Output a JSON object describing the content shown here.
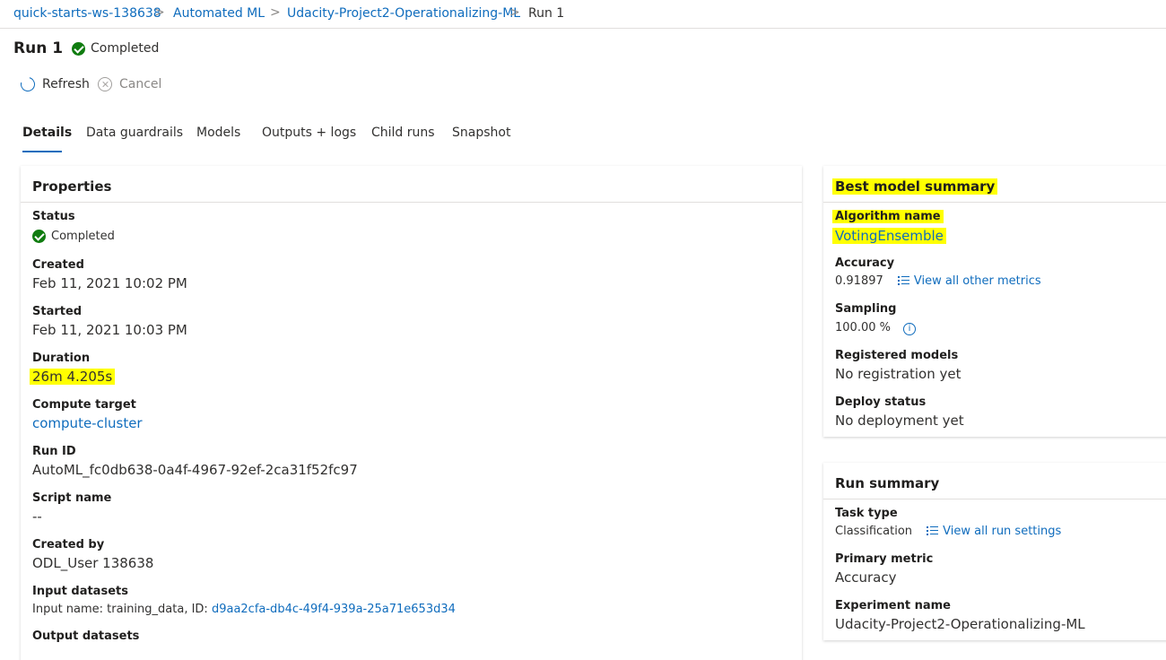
{
  "breadcrumb": {
    "items": [
      "quick-starts-ws-138638",
      "Automated ML",
      "Udacity-Project2-Operationalizing-ML",
      "Run 1"
    ],
    "separator": ">"
  },
  "header": {
    "title": "Run 1",
    "status": "Completed"
  },
  "commands": {
    "refresh": "Refresh",
    "cancel": "Cancel"
  },
  "tabs": [
    "Details",
    "Data guardrails",
    "Models",
    "Outputs + logs",
    "Child runs",
    "Snapshot"
  ],
  "properties": {
    "title": "Properties",
    "status_label": "Status",
    "status_value": "Completed",
    "created_label": "Created",
    "created_value": "Feb 11, 2021 10:02 PM",
    "started_label": "Started",
    "started_value": "Feb 11, 2021 10:03 PM",
    "duration_label": "Duration",
    "duration_value": "26m 4.205s",
    "compute_label": "Compute target",
    "compute_value": "compute-cluster",
    "runid_label": "Run ID",
    "runid_value": "AutoML_fc0db638-0a4f-4967-92ef-2ca31f52fc97",
    "script_label": "Script name",
    "script_value": "--",
    "createdby_label": "Created by",
    "createdby_value": "ODL_User 138638",
    "input_label": "Input datasets",
    "input_prefix": "Input name: training_data, ID:",
    "input_id": "d9aa2cfa-db4c-49f4-939a-25a71e653d34",
    "output_label": "Output datasets"
  },
  "best_model": {
    "title": "Best model summary",
    "algorithm_label": "Algorithm name",
    "algorithm_value": "VotingEnsemble",
    "accuracy_label": "Accuracy",
    "accuracy_value": "0.91897",
    "metrics_link": "View all other metrics",
    "sampling_label": "Sampling",
    "sampling_value": "100.00 %",
    "registered_label": "Registered models",
    "registered_value": "No registration yet",
    "deploy_label": "Deploy status",
    "deploy_value": "No deployment yet"
  },
  "run_summary": {
    "title": "Run summary",
    "task_label": "Task type",
    "task_value": "Classification",
    "settings_link": "View all run settings",
    "primary_label": "Primary metric",
    "primary_value": "Accuracy",
    "experiment_label": "Experiment name",
    "experiment_value": "Udacity-Project2-Operationalizing-ML"
  },
  "colors": {
    "accent": "#0f6cbd",
    "success": "#107c10",
    "highlight": "#ffff00"
  }
}
